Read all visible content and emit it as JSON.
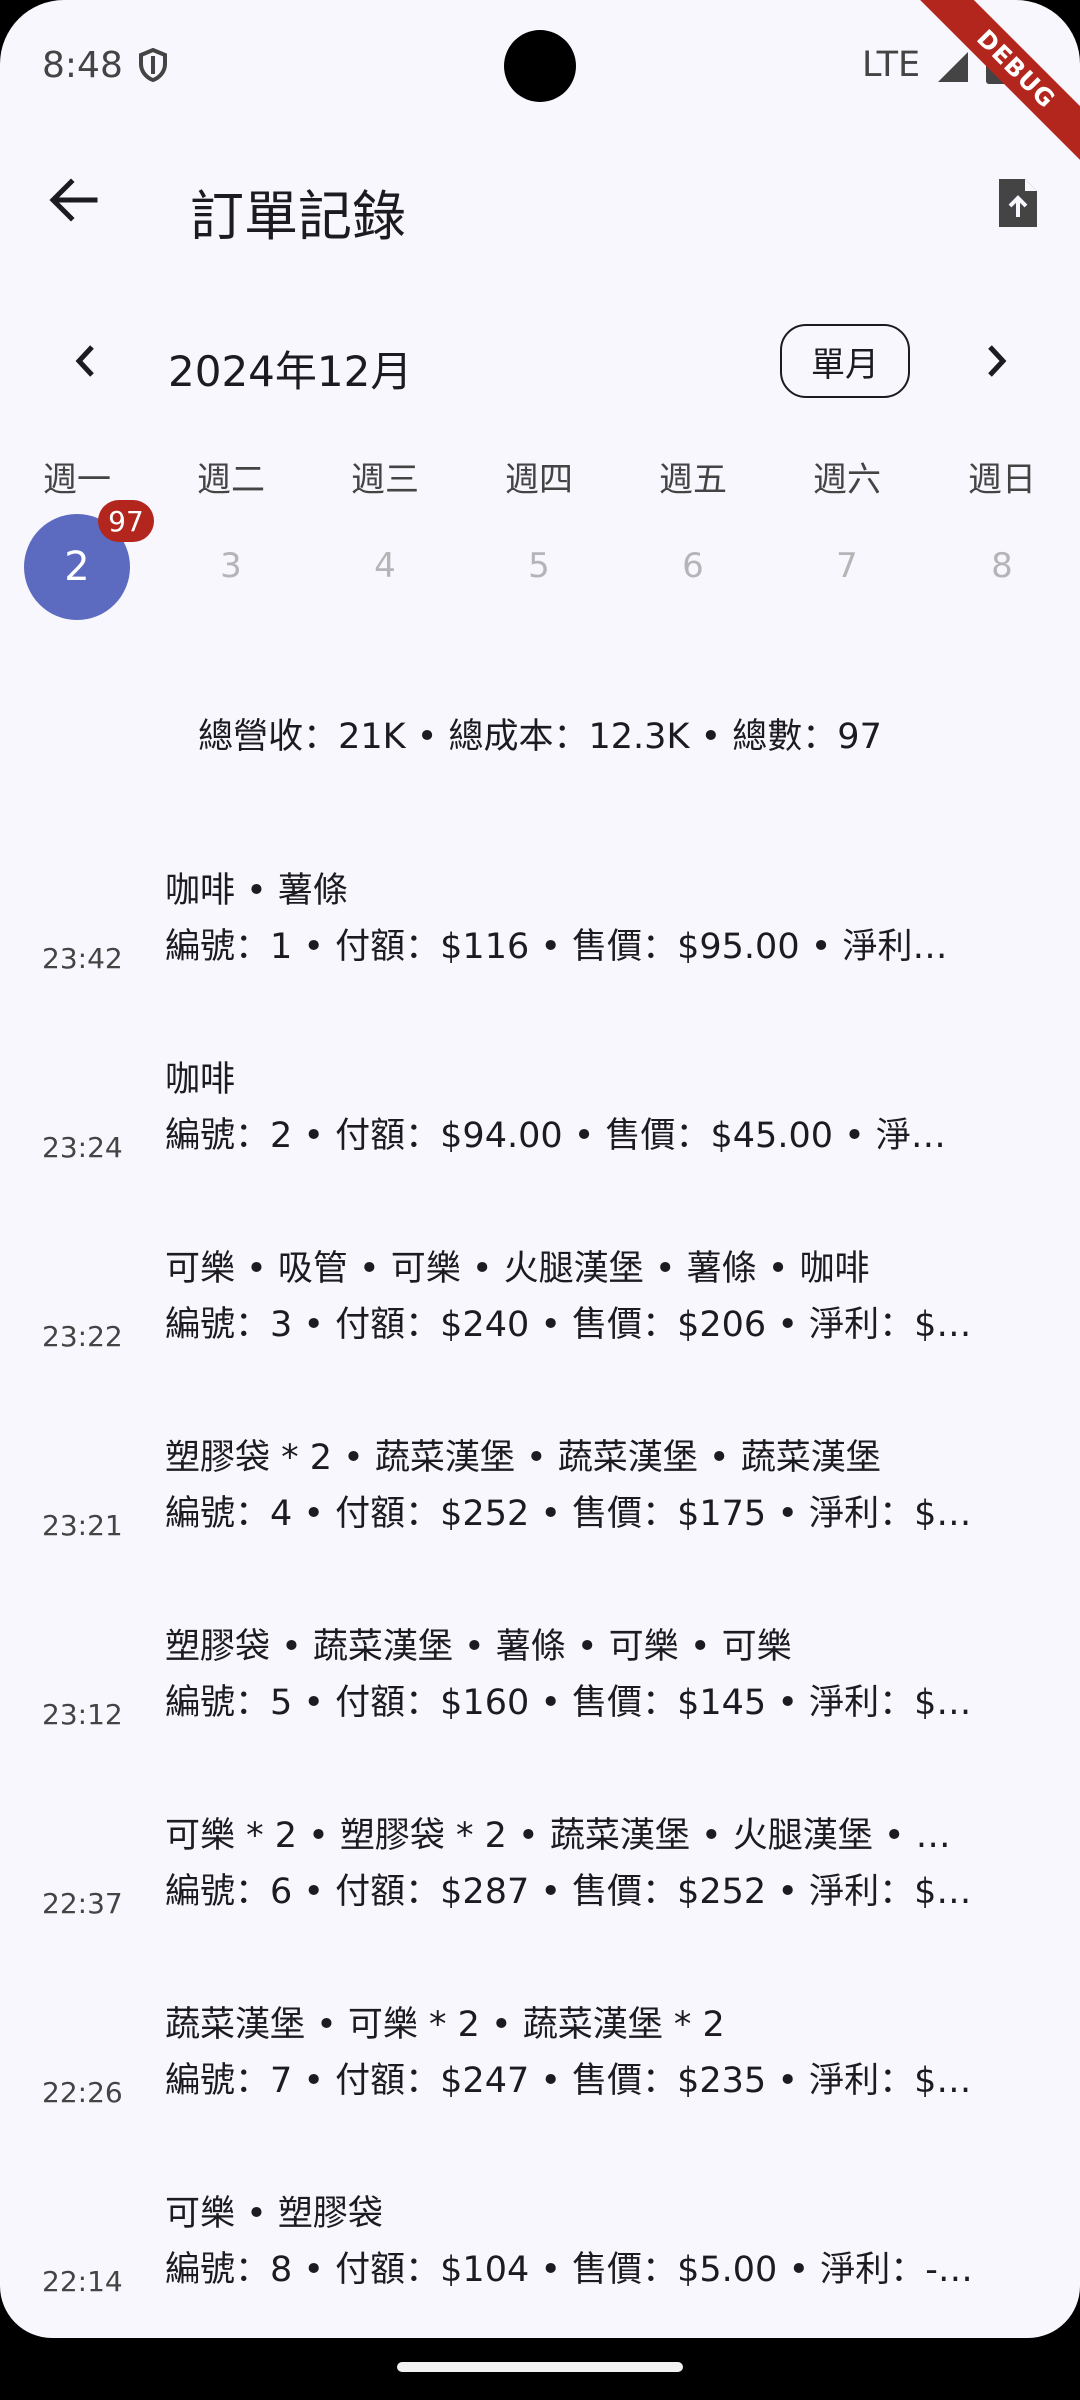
{
  "status_bar": {
    "time": "8:48",
    "network": "LTE",
    "debug_label": "DEBUG"
  },
  "app_bar": {
    "title": "訂單記錄"
  },
  "month_nav": {
    "month": "2024年12月",
    "range_chip": "單月"
  },
  "calendar": {
    "weekdays": [
      "週一",
      "週二",
      "週三",
      "週四",
      "週五",
      "週六",
      "週日"
    ],
    "days": [
      "2",
      "3",
      "4",
      "5",
      "6",
      "7",
      "8"
    ],
    "selected_day": "2",
    "selected_badge": "97",
    "selected_color": "#5c6bc0",
    "badge_color": "#b3261e"
  },
  "summary": "總營收：21K • 總成本：12.3K • 總數：97",
  "orders": [
    {
      "time": "23:42",
      "items": "咖啡 • 薯條",
      "detail": "編號：1 • 付額：$116 • 售價：$95.00 • 淨利…"
    },
    {
      "time": "23:24",
      "items": "咖啡",
      "detail": "編號：2 • 付額：$94.00 • 售價：$45.00 • 淨…"
    },
    {
      "time": "23:22",
      "items": "可樂 • 吸管 • 可樂 • 火腿漢堡 • 薯條 • 咖啡",
      "detail": "編號：3 • 付額：$240 • 售價：$206 • 淨利：$…"
    },
    {
      "time": "23:21",
      "items": "塑膠袋 * 2 • 蔬菜漢堡 • 蔬菜漢堡 • 蔬菜漢堡",
      "detail": "編號：4 • 付額：$252 • 售價：$175 • 淨利：$…"
    },
    {
      "time": "23:12",
      "items": "塑膠袋 • 蔬菜漢堡 • 薯條 • 可樂 • 可樂",
      "detail": "編號：5 • 付額：$160 • 售價：$145 • 淨利：$…"
    },
    {
      "time": "22:37",
      "items": "可樂 * 2 • 塑膠袋 * 2 • 蔬菜漢堡 • 火腿漢堡 • …",
      "detail": "編號：6 • 付額：$287 • 售價：$252 • 淨利：$…"
    },
    {
      "time": "22:26",
      "items": "蔬菜漢堡 • 可樂 * 2 • 蔬菜漢堡 * 2",
      "detail": "編號：7 • 付額：$247 • 售價：$235 • 淨利：$…"
    },
    {
      "time": "22:14",
      "items": "可樂 • 塑膠袋",
      "detail": "編號：8 • 付額：$104 • 售價：$5.00 • 淨利：-…"
    }
  ]
}
